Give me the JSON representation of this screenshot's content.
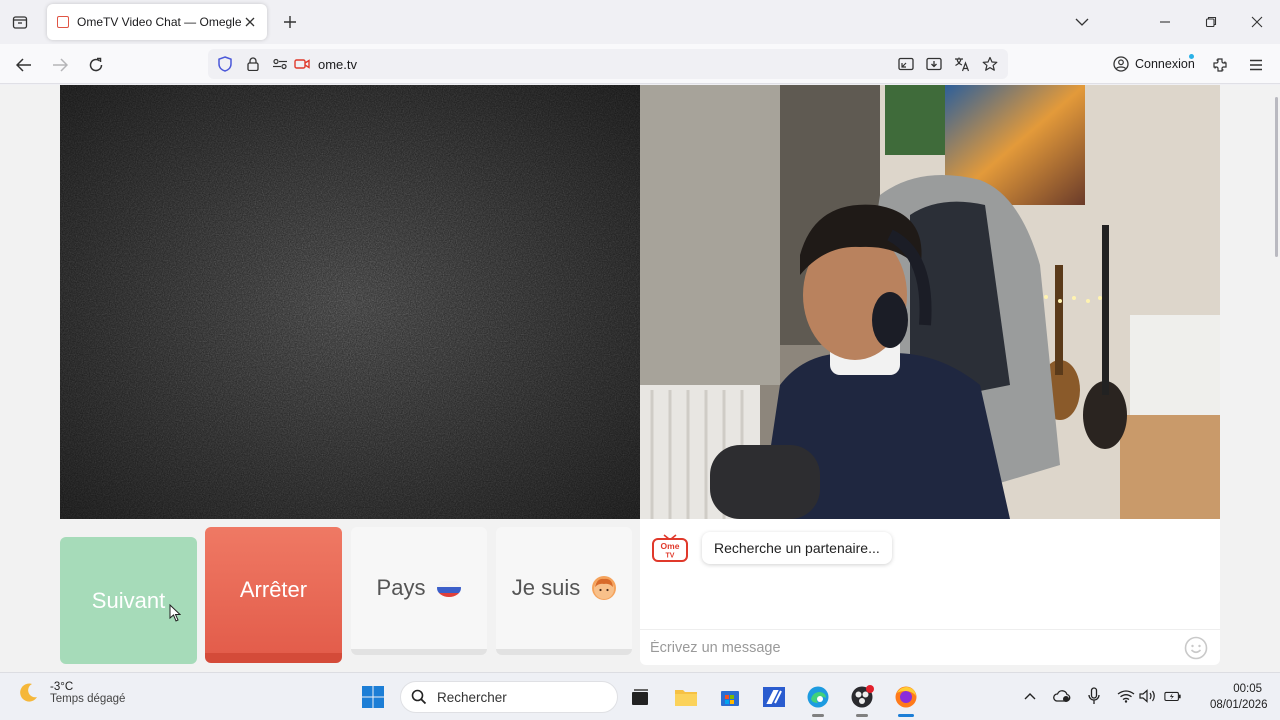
{
  "browser": {
    "tab_title": "OmeTV Video Chat — Omegle",
    "url": "ome.tv",
    "account_button_label": "Connexion"
  },
  "page": {
    "controls": {
      "next_label": "Suivant",
      "stop_label": "Arrêter",
      "country_label": "Pays",
      "gender_label": "Je suis"
    },
    "chat": {
      "logo_text_line1": "Ome",
      "logo_text_line2": "TV",
      "status_message": "Recherche un partenaire...",
      "input_placeholder": "Écrivez un message"
    }
  },
  "taskbar": {
    "weather_temp": "-3°C",
    "weather_desc": "Temps dégagé",
    "search_placeholder": "Rechercher",
    "time": "00:05",
    "date": "08/01/2026"
  },
  "colors": {
    "next_button": "#a6dbb9",
    "stop_button": "#e96a55",
    "neutral_button": "#f7f7f7"
  }
}
